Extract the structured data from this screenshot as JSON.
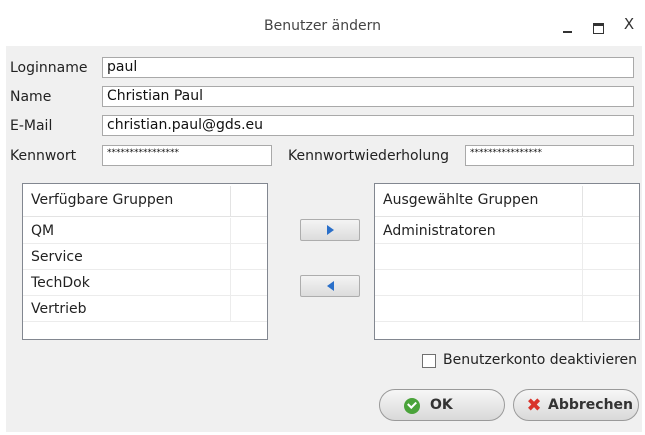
{
  "window": {
    "title": "Benutzer ändern",
    "close_glyph": "X"
  },
  "form": {
    "login_label": "Loginname",
    "login_value": "paul",
    "name_label": "Name",
    "name_value": "Christian Paul",
    "email_label": "E-Mail",
    "email_value": "christian.paul@gds.eu",
    "password_label": "Kennwort",
    "password_value": "****************",
    "password_repeat_label": "Kennwortwiederholung",
    "password_repeat_value": "****************"
  },
  "available_groups": {
    "header": "Verfügbare Gruppen",
    "items": [
      "QM",
      "Service",
      "TechDok",
      "Vertrieb"
    ]
  },
  "selected_groups": {
    "header": "Ausgewählte Gruppen",
    "items": [
      "Administratoren"
    ]
  },
  "options": {
    "deactivate_label": "Benutzerkonto deaktivieren",
    "deactivate_checked": false
  },
  "buttons": {
    "ok_label": "OK",
    "cancel_label": "Abbrechen"
  },
  "icons": {
    "add": "arrow-right-icon",
    "remove": "arrow-left-icon",
    "ok": "check-circle-icon",
    "cancel": "x-icon"
  },
  "colors": {
    "arrow": "#2a6fc9",
    "ok_green": "#4aa33a",
    "cancel_red": "#d9342b"
  }
}
